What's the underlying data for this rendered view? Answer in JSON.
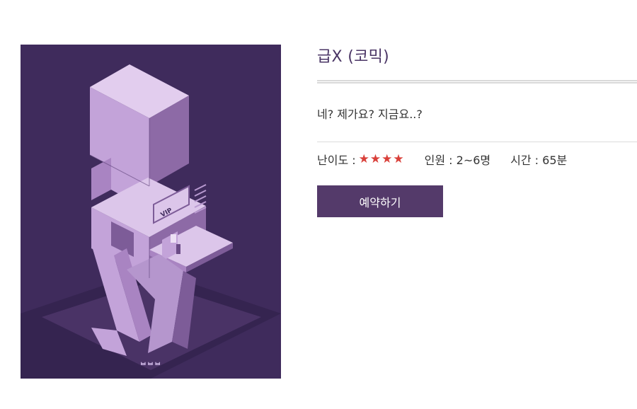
{
  "product": {
    "title": "급X (코믹)",
    "description": "네? 제가요? 지금요..?",
    "difficulty_label": "난이도 :",
    "difficulty_stars": 4,
    "players_label": "인원 : 2~6명",
    "time_label": "시간 : 65분",
    "reserve_button_label": "예약하기"
  },
  "poster": {
    "caption": "ᄇᄇᄇ",
    "sign_text": "VIP ROOM"
  },
  "colors": {
    "accent": "#543a6a",
    "title": "#4a3565",
    "star": "#d9403a",
    "poster_bg": "#3f2b5c"
  }
}
